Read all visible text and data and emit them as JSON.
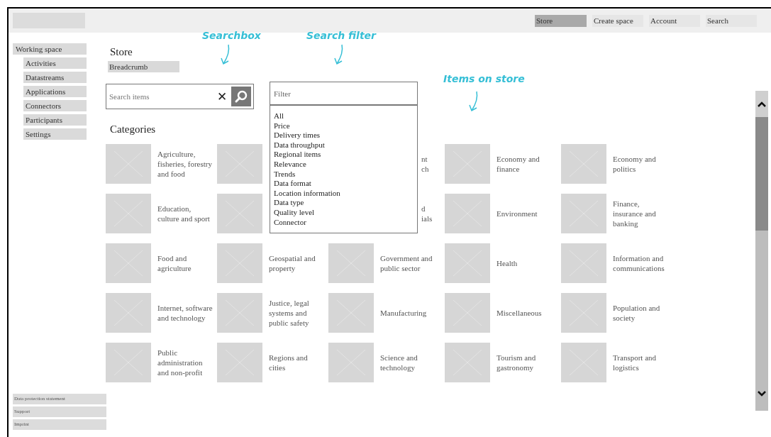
{
  "nav": [
    {
      "label": "Store",
      "selected": true
    },
    {
      "label": "Create space",
      "selected": false
    },
    {
      "label": "Account",
      "selected": false
    },
    {
      "label": "Search",
      "selected": false
    }
  ],
  "sidebar": {
    "items": [
      {
        "label": "Working space",
        "children": [
          {
            "label": "Activities"
          },
          {
            "label": "Datastreams"
          },
          {
            "label": "Applications"
          },
          {
            "label": "Connectors"
          },
          {
            "label": "Participants"
          },
          {
            "label": "Settings"
          }
        ]
      }
    ]
  },
  "page_title": "Store",
  "breadcrumb": "Breadcrumb",
  "search": {
    "placeholder": "Search items",
    "clear": "✕"
  },
  "filter": {
    "placeholder": "Filter",
    "options": [
      "All",
      "Price",
      "Delivery times",
      "Data throughput",
      "Regional items",
      "Relevance",
      "Trends",
      "Data format",
      "Location information",
      "Data type",
      "Quality level",
      "Connector"
    ]
  },
  "annotations": [
    {
      "text": "Searchbox"
    },
    {
      "text": "Search filter"
    },
    {
      "text": "Items on store"
    }
  ],
  "categories": {
    "title": "Categories",
    "items": [
      {
        "kind": "full",
        "label": "Agriculture, fisheries, forestry and food"
      },
      {
        "kind": "hidden"
      },
      {
        "kind": "partial",
        "lines": [
          "nt",
          "ch"
        ]
      },
      {
        "kind": "full",
        "label": "Economy and finance"
      },
      {
        "kind": "full",
        "label": "Economy and politics"
      },
      {
        "kind": "full",
        "label": "Education, culture and sport"
      },
      {
        "kind": "hidden"
      },
      {
        "kind": "partial",
        "lines": [
          "d",
          "ials"
        ]
      },
      {
        "kind": "full",
        "label": "Environment"
      },
      {
        "kind": "full",
        "label": "Finance, insurance and banking"
      },
      {
        "kind": "full",
        "label": "Food and agriculture"
      },
      {
        "kind": "full",
        "label": "Geospatial and property"
      },
      {
        "kind": "full",
        "label": "Government and public sector"
      },
      {
        "kind": "full",
        "label": "Health"
      },
      {
        "kind": "full",
        "label": "Information and communications"
      },
      {
        "kind": "full",
        "label": "Internet, software and technology"
      },
      {
        "kind": "full",
        "label": "Justice, legal systems and public safety"
      },
      {
        "kind": "full",
        "label": "Manufacturing"
      },
      {
        "kind": "full",
        "label": "Miscellaneous"
      },
      {
        "kind": "full",
        "label": "Population and society"
      },
      {
        "kind": "full",
        "label": "Public administration and non-profit"
      },
      {
        "kind": "full",
        "label": "Regions and cities"
      },
      {
        "kind": "full",
        "label": "Science and technology"
      },
      {
        "kind": "full",
        "label": "Tourism and gastronomy"
      },
      {
        "kind": "full",
        "label": "Transport and logistics"
      }
    ]
  },
  "footer_links": [
    "Data protection statement",
    "Support",
    "Imprint"
  ]
}
